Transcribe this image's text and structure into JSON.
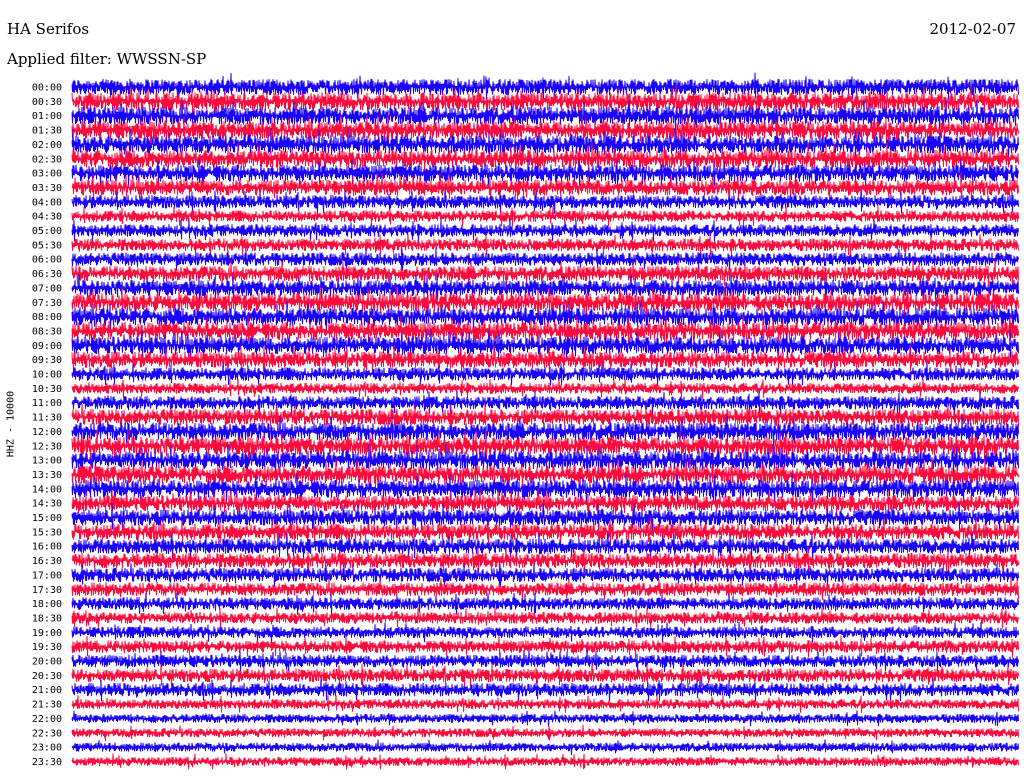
{
  "header": {
    "station": "HA Serifos",
    "date": "2012-02-07",
    "filter": "Applied filter: WWSSN-SP"
  },
  "channel_label": "HHZ - 10000",
  "colors": {
    "trace_a": "#1a00ff",
    "trace_b": "#ff0a3c",
    "background": "#ffffff"
  },
  "chart_data": {
    "type": "line",
    "title": "HA Serifos",
    "subtitle": "Applied filter: WWSSN-SP",
    "ylabel": "HHZ - 10000",
    "grid": false,
    "row_interval_minutes": 30,
    "row_labels": [
      "00:00",
      "00:30",
      "01:00",
      "01:30",
      "02:00",
      "02:30",
      "03:00",
      "03:30",
      "04:00",
      "04:30",
      "05:00",
      "05:30",
      "06:00",
      "06:30",
      "07:00",
      "07:30",
      "08:00",
      "08:30",
      "09:00",
      "09:30",
      "10:00",
      "10:30",
      "11:00",
      "11:30",
      "12:00",
      "12:30",
      "13:00",
      "13:30",
      "14:00",
      "14:30",
      "15:00",
      "15:30",
      "16:00",
      "16:30",
      "17:00",
      "17:30",
      "18:00",
      "18:30",
      "19:00",
      "19:30",
      "20:00",
      "20:30",
      "21:00",
      "21:30",
      "22:00",
      "22:30",
      "23:00",
      "23:30"
    ],
    "row_amplitude": [
      0.9,
      1.0,
      1.0,
      1.0,
      1.0,
      1.0,
      0.95,
      0.9,
      0.75,
      0.65,
      0.7,
      0.7,
      0.75,
      0.85,
      0.9,
      1.0,
      1.0,
      1.0,
      1.0,
      0.9,
      0.75,
      0.6,
      0.75,
      0.9,
      1.0,
      1.0,
      1.0,
      1.0,
      1.0,
      0.9,
      0.9,
      0.9,
      0.85,
      0.85,
      0.8,
      0.75,
      0.7,
      0.65,
      0.65,
      0.7,
      0.7,
      0.75,
      0.75,
      0.55,
      0.5,
      0.5,
      0.5,
      0.5
    ],
    "series": [
      {
        "color": "#1a00ff",
        "rows": "even"
      },
      {
        "color": "#ff0a3c",
        "rows": "odd"
      }
    ]
  }
}
